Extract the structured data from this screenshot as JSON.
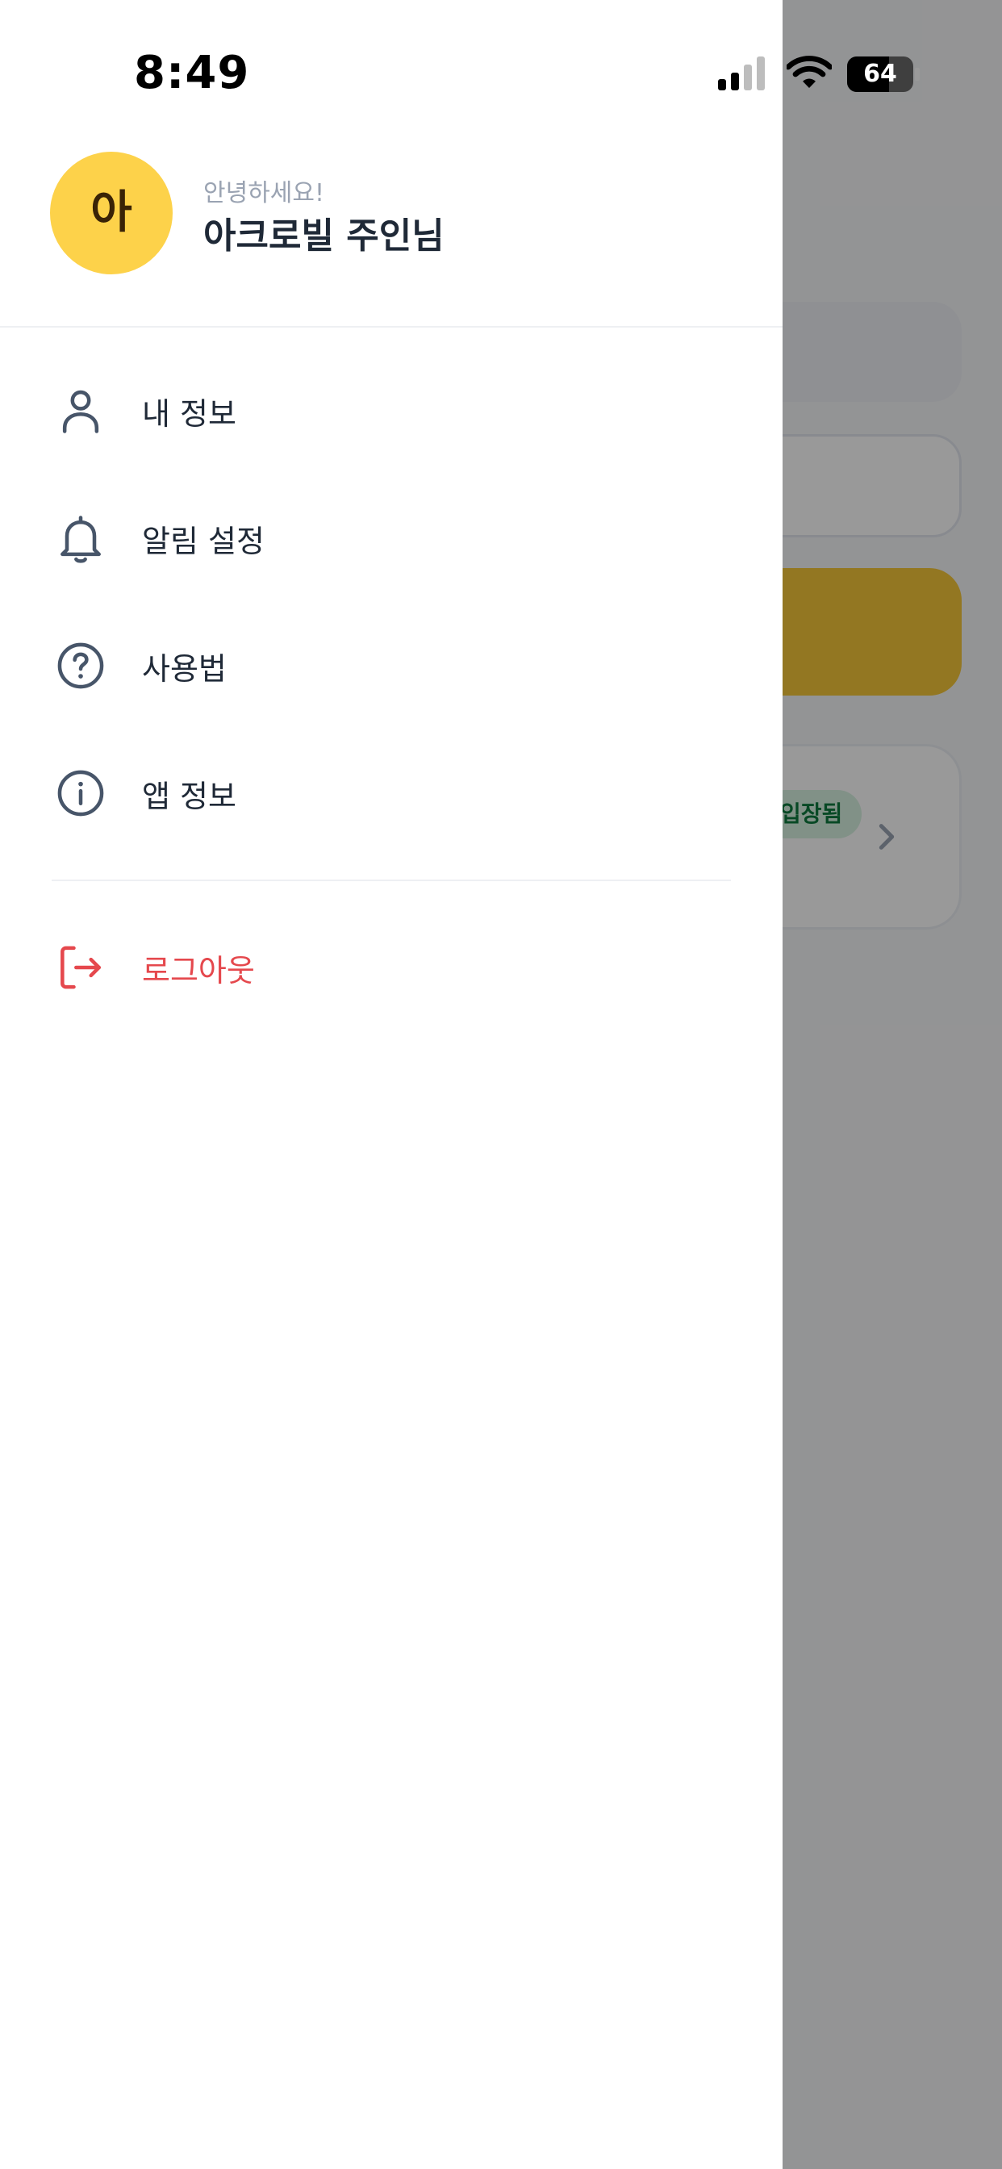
{
  "status_bar": {
    "time": "8:49",
    "battery_percent": "64",
    "battery_level": 0.64,
    "signal_bars": 2
  },
  "profile": {
    "avatar_initial": "아",
    "greeting": "안녕하세요!",
    "name": "아크로빌 주인님"
  },
  "menu": [
    {
      "label": "내 정보",
      "icon": "user-icon"
    },
    {
      "label": "알림 설정",
      "icon": "bell-icon"
    },
    {
      "label": "사용법",
      "icon": "help-circle-icon"
    },
    {
      "label": "앱 정보",
      "icon": "info-icon"
    }
  ],
  "logout": {
    "label": "로그아웃",
    "icon": "logout-icon"
  },
  "background": {
    "badge": "입장됨"
  },
  "colors": {
    "accent": "#FDD24A",
    "danger": "#E5484D",
    "icon": "#475569",
    "badge_bg": "#D8F2E1",
    "badge_text": "#0E7A3E"
  }
}
